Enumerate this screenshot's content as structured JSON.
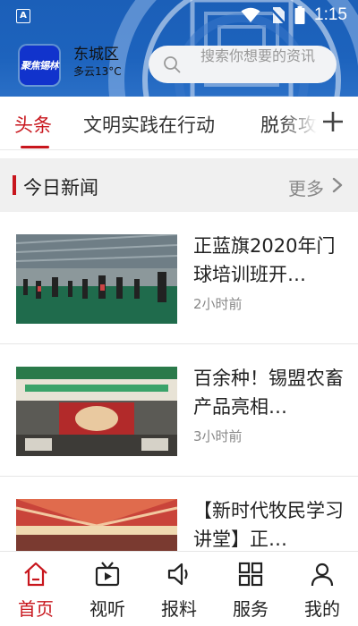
{
  "status_bar": {
    "time": "1:15",
    "app_icon_letter": "A"
  },
  "header": {
    "logo_text": "聚焦锡林",
    "district": "东城区",
    "weather": "多云13°C",
    "search": {
      "placeholder": "搜索你想要的资讯"
    }
  },
  "tabs": {
    "items": [
      {
        "label": "头条",
        "active": true
      },
      {
        "label": "文明实践在行动",
        "active": false
      },
      {
        "label": "脱贫攻坚",
        "active": false
      }
    ],
    "add_icon": "plus-icon"
  },
  "section": {
    "title": "今日新闻",
    "more_label": "更多"
  },
  "news": [
    {
      "title": "正蓝旗2020年门球培训班开…",
      "time": "2小时前"
    },
    {
      "title": "百余种！锡盟农畜产品亮相…",
      "time": "3小时前"
    },
    {
      "title": "【新时代牧民学习讲堂】正…",
      "time": ""
    }
  ],
  "bottom_nav": [
    {
      "label": "首页",
      "icon": "home-icon",
      "active": true
    },
    {
      "label": "视听",
      "icon": "video-icon",
      "active": false
    },
    {
      "label": "报料",
      "icon": "megaphone-icon",
      "active": false
    },
    {
      "label": "服务",
      "icon": "grid-icon",
      "active": false
    },
    {
      "label": "我的",
      "icon": "person-icon",
      "active": false
    }
  ],
  "colors": {
    "accent": "#c8161d",
    "header_blue": "#1d63bd",
    "logo_blue": "#1133cc"
  }
}
